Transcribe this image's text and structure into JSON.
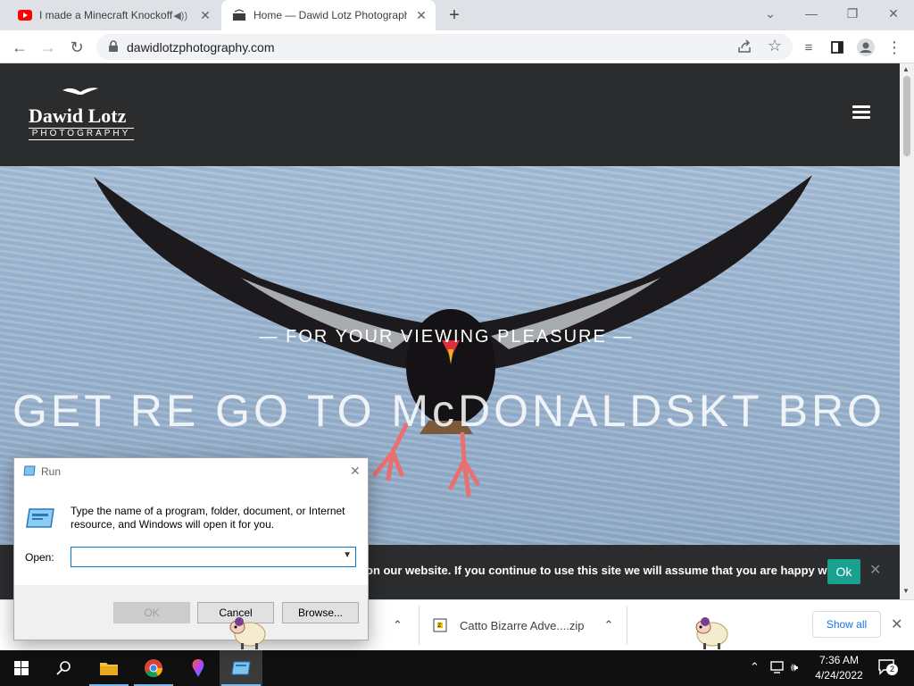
{
  "browser": {
    "tabs": [
      {
        "title": "I made a Minecraft Knockoff",
        "favicon": "youtube-icon",
        "audio": true,
        "active": false
      },
      {
        "title": "Home — Dawid Lotz Photograph",
        "favicon": "site-favicon",
        "audio": false,
        "active": true
      }
    ],
    "url": "dawidlotzphotography.com"
  },
  "site": {
    "logo_name": "Dawid Lotz",
    "logo_sub": "PHOTOGRAPHY",
    "tagline": "— FOR YOUR VIEWING PLEASURE —",
    "headline": "GET RE GO TO McDONALDSKT BRO"
  },
  "cookie_bar": {
    "message": "on our website. If you continue to use this site we will assume that you are happy with it.",
    "ok_label": "Ok"
  },
  "downloads": {
    "items": [
      {
        "name": "Catto Bizarre Adve....zip"
      }
    ],
    "show_all_label": "Show all"
  },
  "run_dialog": {
    "title": "Run",
    "description": "Type the name of a program, folder, document, or Internet resource, and Windows will open it for you.",
    "open_label": "Open:",
    "open_value": "",
    "ok_label": "OK",
    "cancel_label": "Cancel",
    "browse_label": "Browse..."
  },
  "taskbar": {
    "time": "7:36 AM",
    "date": "4/24/2022",
    "notification_count": "2"
  },
  "colors": {
    "site_header": "#2a2c2e",
    "cookie_ok": "#1aa090",
    "taskbar": "#101010",
    "accent_blue": "#1a73e8"
  }
}
